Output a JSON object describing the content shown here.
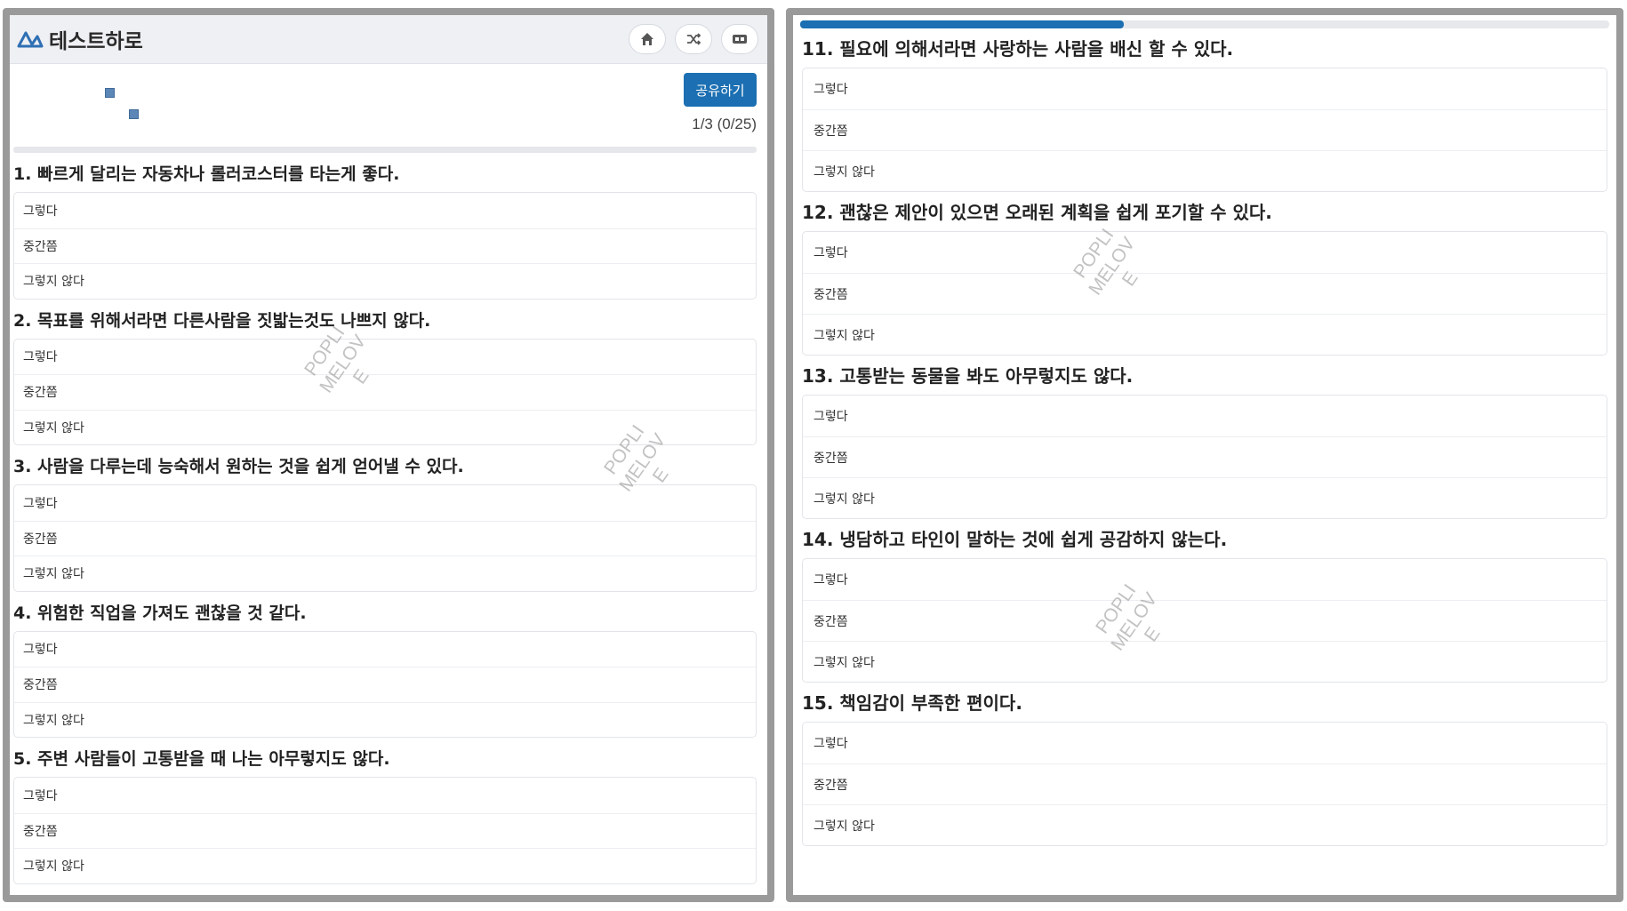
{
  "header": {
    "title": "테스트하로"
  },
  "toolbar": {
    "share_label": "공유하기",
    "page_count": "1/3 (0/25)"
  },
  "progress": {
    "fraction": 0.4
  },
  "watermark": "POPLI\nMELOV\nE",
  "left_questions": [
    {
      "title": "1. 빠르게 달리는 자동차나 롤러코스터를 타는게 좋다.",
      "options": [
        "그렇다",
        "중간쯤",
        "그렇지 않다"
      ]
    },
    {
      "title": "2. 목표를 위해서라면 다른사람을 짓밟는것도 나쁘지 않다.",
      "options": [
        "그렇다",
        "중간쯤",
        "그렇지 않다"
      ]
    },
    {
      "title": "3. 사람을 다루는데 능숙해서 원하는 것을 쉽게 얻어낼 수 있다.",
      "options": [
        "그렇다",
        "중간쯤",
        "그렇지 않다"
      ]
    },
    {
      "title": "4. 위험한 직업을 가져도 괜찮을 것 같다.",
      "options": [
        "그렇다",
        "중간쯤",
        "그렇지 않다"
      ]
    },
    {
      "title": "5. 주변 사람들이 고통받을 때 나는 아무렇지도 않다.",
      "options": [
        "그렇다",
        "중간쯤",
        "그렇지 않다"
      ]
    }
  ],
  "right_questions": [
    {
      "title": "11. 필요에 의해서라면 사랑하는 사람을 배신 할 수 있다.",
      "options": [
        "그렇다",
        "중간쯤",
        "그렇지 않다"
      ]
    },
    {
      "title": "12. 괜찮은 제안이 있으면 오래된 계획을 쉽게 포기할 수 있다.",
      "options": [
        "그렇다",
        "중간쯤",
        "그렇지 않다"
      ]
    },
    {
      "title": "13. 고통받는 동물을 봐도 아무렇지도 않다.",
      "options": [
        "그렇다",
        "중간쯤",
        "그렇지 않다"
      ]
    },
    {
      "title": "14. 냉담하고 타인이 말하는 것에 쉽게 공감하지 않는다.",
      "options": [
        "그렇다",
        "중간쯤",
        "그렇지 않다"
      ]
    },
    {
      "title": "15. 책임감이 부족한 편이다.",
      "options": [
        "그렇다",
        "중간쯤",
        "그렇지 않다"
      ]
    }
  ]
}
